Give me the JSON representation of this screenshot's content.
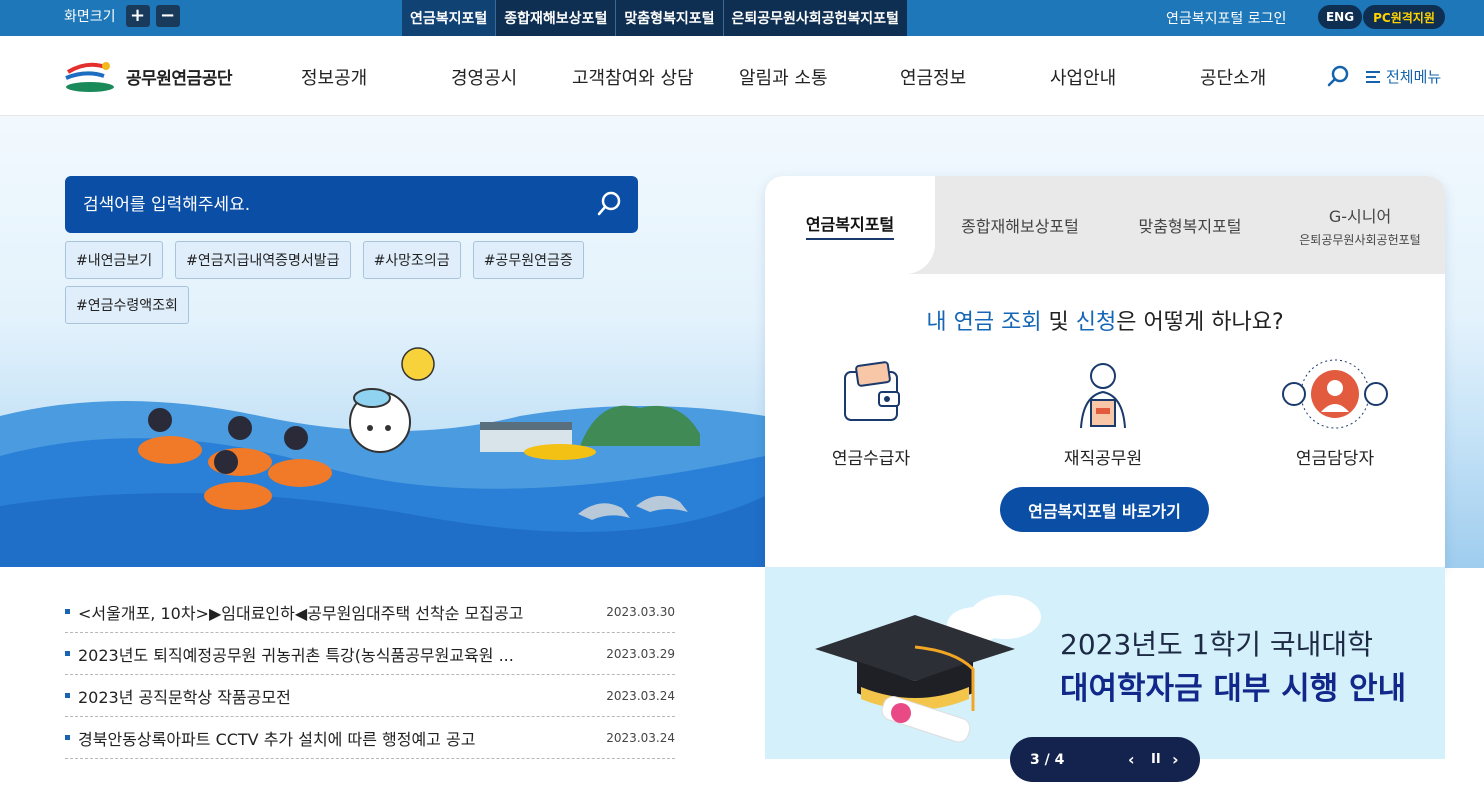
{
  "topbar": {
    "fontsize_label": "화면크기",
    "plus": "+",
    "minus": "−",
    "portals": [
      "연금복지포털",
      "종합재해보상포털",
      "맞춤형복지포털",
      "은퇴공무원사회공헌복지포털"
    ],
    "login": "연금복지포털 로그인",
    "eng": "ENG",
    "remote": "PC원격지원"
  },
  "header": {
    "logo_text": "공무원연금공단",
    "menu": [
      "정보공개",
      "경영공시",
      "고객참여와 상담",
      "알림과 소통",
      "연금정보",
      "사업안내",
      "공단소개"
    ],
    "all_menu": "전체메뉴"
  },
  "search": {
    "placeholder": "검색어를 입력해주세요.",
    "tags": [
      "#내연금보기",
      "#연금지급내역증명서발급",
      "#사망조의금",
      "#공무원연금증",
      "#연금수령액조회"
    ]
  },
  "portal_card": {
    "tabs": [
      {
        "label": "연금복지포털",
        "sub": ""
      },
      {
        "label": "종합재해보상포털",
        "sub": ""
      },
      {
        "label": "맞춤형복지포털",
        "sub": ""
      },
      {
        "label": "G-시니어",
        "sub": "은퇴공무원사회공헌포털"
      }
    ],
    "question": {
      "p1": "내 연금 조회",
      "p2": " 및 ",
      "p3": "신청",
      "p4": "은 어떻게 하나요?"
    },
    "icons": [
      "연금수급자",
      "재직공무원",
      "연금담당자"
    ],
    "button": "연금복지포털 바로가기"
  },
  "news": [
    {
      "title": "<서울개포, 10차>▶임대료인하◀공무원임대주택 선착순 모집공고",
      "date": "2023.03.30"
    },
    {
      "title": "2023년도 퇴직예정공무원 귀농귀촌 특강(농식품공무원교육원 ...",
      "date": "2023.03.29"
    },
    {
      "title": "2023년 공직문학상 작품공모전",
      "date": "2023.03.24"
    },
    {
      "title": "경북안동상록아파트 CCTV 추가 설치에 따른 행정예고 공고",
      "date": "2023.03.24"
    }
  ],
  "banner": {
    "line1": "2023년도 1학기 국내대학",
    "line2": "대여학자금 대부 시행 안내",
    "pager": "3 / 4",
    "prev": "‹",
    "pause": "II",
    "next": "›"
  },
  "colors": {
    "topbar": "#1d77b8",
    "navy": "#0f2f52",
    "primary": "#0a4ea5",
    "accent": "#1566b5"
  }
}
